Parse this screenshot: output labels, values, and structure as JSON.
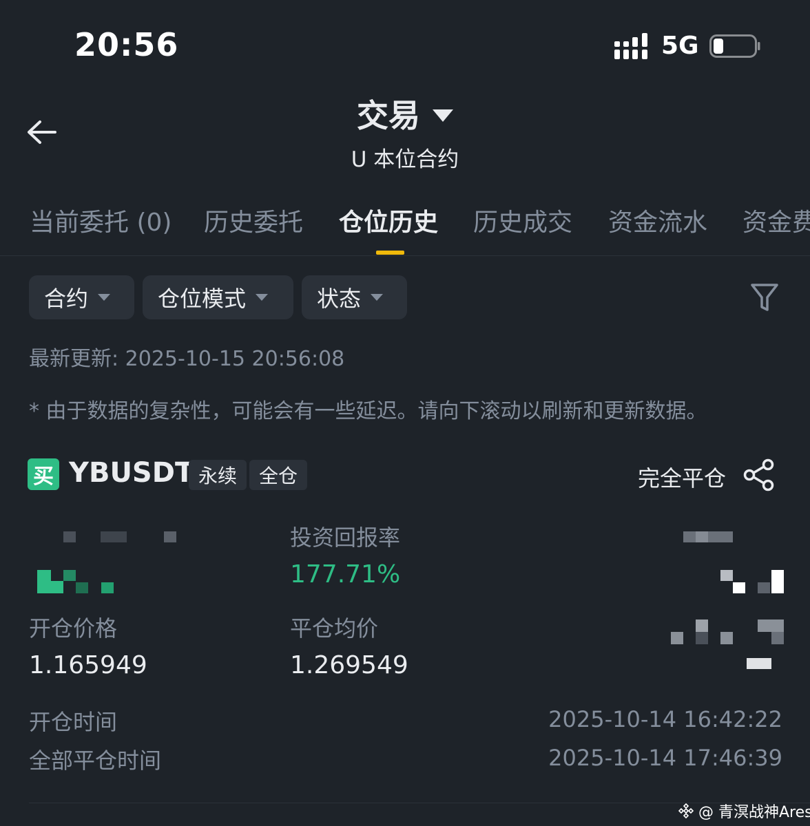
{
  "status_bar": {
    "time": "20:56",
    "network": "5G"
  },
  "header": {
    "title": "交易",
    "subtitle": "U 本位合约"
  },
  "tabs": [
    {
      "label": "当前委托 (0)"
    },
    {
      "label": "历史委托"
    },
    {
      "label": "仓位历史",
      "active": true
    },
    {
      "label": "历史成交"
    },
    {
      "label": "资金流水"
    },
    {
      "label": "资金费"
    }
  ],
  "filters": [
    {
      "label": "合约"
    },
    {
      "label": "仓位模式"
    },
    {
      "label": "状态"
    }
  ],
  "updated": "最新更新: 2025-10-15 20:56:08",
  "notice": "* 由于数据的复杂性，可能会有一些延迟。请向下滚动以刷新和更新数据。",
  "position": {
    "side": "买",
    "symbol": "YBUSDT",
    "tags": [
      "永续",
      "全仓"
    ],
    "close_status": "完全平仓",
    "roi_label": "投资回报率",
    "roi_value": "177.71%",
    "open_price_label": "开仓价格",
    "open_price": "1.165949",
    "close_price_label": "平仓均价",
    "close_price": "1.269549",
    "open_time_label": "开仓时间",
    "open_time": "2025-10-14 16:42:22",
    "close_time_label": "全部平仓时间",
    "close_time": "2025-10-14 17:46:39"
  },
  "watermark": "@ 青溟战神Ares",
  "colors": {
    "background": "#1e2329",
    "surface": "#2b3139",
    "accent": "#f0b90b",
    "positive": "#2ebd85",
    "muted": "#848e9c",
    "text": "#eaecef"
  },
  "icons": [
    "signal-icon",
    "battery-icon",
    "back-arrow-icon",
    "dropdown-caret-icon",
    "filter-icon",
    "share-icon",
    "watermark-logo-icon"
  ]
}
